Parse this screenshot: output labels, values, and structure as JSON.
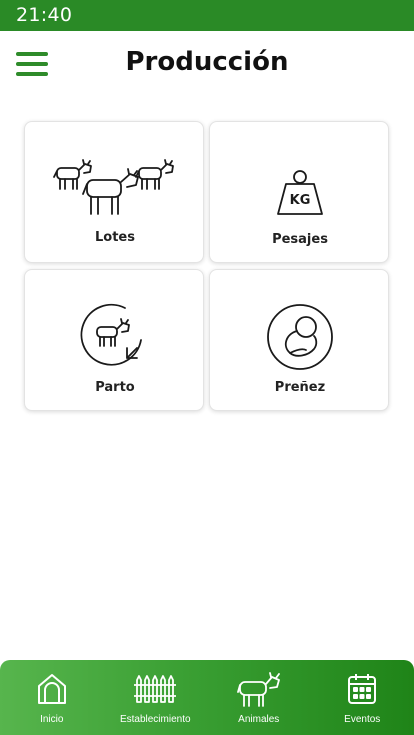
{
  "status_bar": {
    "time": "21:40"
  },
  "header": {
    "title": "Producción",
    "menu_icon": "hamburger-menu-icon"
  },
  "tiles": [
    {
      "label": "Lotes",
      "icon": "herd-icon"
    },
    {
      "label": "Pesajes",
      "icon": "weight-kg-icon",
      "icon_text": "KG"
    },
    {
      "label": "Parto",
      "icon": "calf-birth-icon"
    },
    {
      "label": "Preñez",
      "icon": "pregnancy-icon"
    }
  ],
  "bottom_nav": {
    "items": [
      {
        "label": "Inicio",
        "icon": "home-icon"
      },
      {
        "label": "Establecimiento",
        "icon": "fence-icon"
      },
      {
        "label": "Animales",
        "icon": "cow-icon"
      },
      {
        "label": "Eventos",
        "icon": "calendar-icon"
      }
    ]
  },
  "colors": {
    "status_bar": "#2a8a26",
    "accent": "#2e8b2a",
    "nav_start": "#57b54d",
    "nav_end": "#1f8418"
  }
}
